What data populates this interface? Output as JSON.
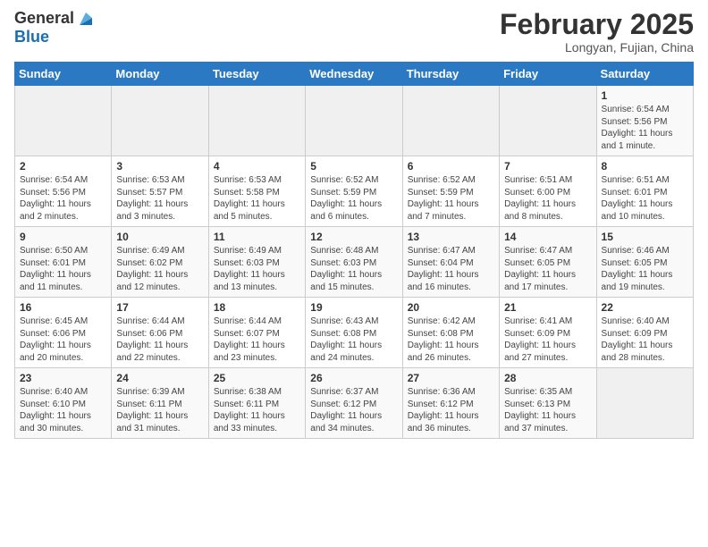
{
  "header": {
    "logo_general": "General",
    "logo_blue": "Blue",
    "month_title": "February 2025",
    "subtitle": "Longyan, Fujian, China"
  },
  "days_of_week": [
    "Sunday",
    "Monday",
    "Tuesday",
    "Wednesday",
    "Thursday",
    "Friday",
    "Saturday"
  ],
  "weeks": [
    [
      {
        "day": "",
        "info": ""
      },
      {
        "day": "",
        "info": ""
      },
      {
        "day": "",
        "info": ""
      },
      {
        "day": "",
        "info": ""
      },
      {
        "day": "",
        "info": ""
      },
      {
        "day": "",
        "info": ""
      },
      {
        "day": "1",
        "info": "Sunrise: 6:54 AM\nSunset: 5:56 PM\nDaylight: 11 hours\nand 1 minute."
      }
    ],
    [
      {
        "day": "2",
        "info": "Sunrise: 6:54 AM\nSunset: 5:56 PM\nDaylight: 11 hours\nand 2 minutes."
      },
      {
        "day": "3",
        "info": "Sunrise: 6:53 AM\nSunset: 5:57 PM\nDaylight: 11 hours\nand 3 minutes."
      },
      {
        "day": "4",
        "info": "Sunrise: 6:53 AM\nSunset: 5:58 PM\nDaylight: 11 hours\nand 5 minutes."
      },
      {
        "day": "5",
        "info": "Sunrise: 6:52 AM\nSunset: 5:59 PM\nDaylight: 11 hours\nand 6 minutes."
      },
      {
        "day": "6",
        "info": "Sunrise: 6:52 AM\nSunset: 5:59 PM\nDaylight: 11 hours\nand 7 minutes."
      },
      {
        "day": "7",
        "info": "Sunrise: 6:51 AM\nSunset: 6:00 PM\nDaylight: 11 hours\nand 8 minutes."
      },
      {
        "day": "8",
        "info": "Sunrise: 6:51 AM\nSunset: 6:01 PM\nDaylight: 11 hours\nand 10 minutes."
      }
    ],
    [
      {
        "day": "9",
        "info": "Sunrise: 6:50 AM\nSunset: 6:01 PM\nDaylight: 11 hours\nand 11 minutes."
      },
      {
        "day": "10",
        "info": "Sunrise: 6:49 AM\nSunset: 6:02 PM\nDaylight: 11 hours\nand 12 minutes."
      },
      {
        "day": "11",
        "info": "Sunrise: 6:49 AM\nSunset: 6:03 PM\nDaylight: 11 hours\nand 13 minutes."
      },
      {
        "day": "12",
        "info": "Sunrise: 6:48 AM\nSunset: 6:03 PM\nDaylight: 11 hours\nand 15 minutes."
      },
      {
        "day": "13",
        "info": "Sunrise: 6:47 AM\nSunset: 6:04 PM\nDaylight: 11 hours\nand 16 minutes."
      },
      {
        "day": "14",
        "info": "Sunrise: 6:47 AM\nSunset: 6:05 PM\nDaylight: 11 hours\nand 17 minutes."
      },
      {
        "day": "15",
        "info": "Sunrise: 6:46 AM\nSunset: 6:05 PM\nDaylight: 11 hours\nand 19 minutes."
      }
    ],
    [
      {
        "day": "16",
        "info": "Sunrise: 6:45 AM\nSunset: 6:06 PM\nDaylight: 11 hours\nand 20 minutes."
      },
      {
        "day": "17",
        "info": "Sunrise: 6:44 AM\nSunset: 6:06 PM\nDaylight: 11 hours\nand 22 minutes."
      },
      {
        "day": "18",
        "info": "Sunrise: 6:44 AM\nSunset: 6:07 PM\nDaylight: 11 hours\nand 23 minutes."
      },
      {
        "day": "19",
        "info": "Sunrise: 6:43 AM\nSunset: 6:08 PM\nDaylight: 11 hours\nand 24 minutes."
      },
      {
        "day": "20",
        "info": "Sunrise: 6:42 AM\nSunset: 6:08 PM\nDaylight: 11 hours\nand 26 minutes."
      },
      {
        "day": "21",
        "info": "Sunrise: 6:41 AM\nSunset: 6:09 PM\nDaylight: 11 hours\nand 27 minutes."
      },
      {
        "day": "22",
        "info": "Sunrise: 6:40 AM\nSunset: 6:09 PM\nDaylight: 11 hours\nand 28 minutes."
      }
    ],
    [
      {
        "day": "23",
        "info": "Sunrise: 6:40 AM\nSunset: 6:10 PM\nDaylight: 11 hours\nand 30 minutes."
      },
      {
        "day": "24",
        "info": "Sunrise: 6:39 AM\nSunset: 6:11 PM\nDaylight: 11 hours\nand 31 minutes."
      },
      {
        "day": "25",
        "info": "Sunrise: 6:38 AM\nSunset: 6:11 PM\nDaylight: 11 hours\nand 33 minutes."
      },
      {
        "day": "26",
        "info": "Sunrise: 6:37 AM\nSunset: 6:12 PM\nDaylight: 11 hours\nand 34 minutes."
      },
      {
        "day": "27",
        "info": "Sunrise: 6:36 AM\nSunset: 6:12 PM\nDaylight: 11 hours\nand 36 minutes."
      },
      {
        "day": "28",
        "info": "Sunrise: 6:35 AM\nSunset: 6:13 PM\nDaylight: 11 hours\nand 37 minutes."
      },
      {
        "day": "",
        "info": ""
      }
    ]
  ]
}
